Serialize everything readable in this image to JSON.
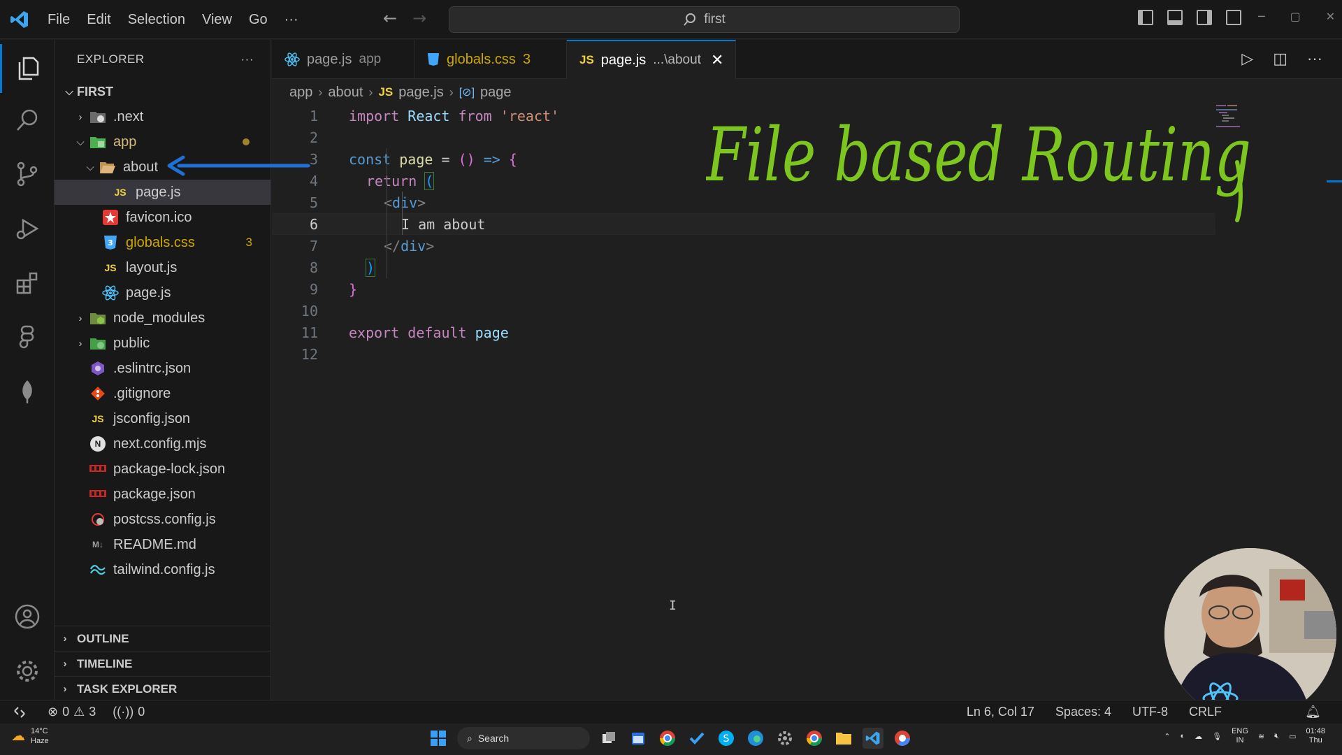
{
  "titlebar": {
    "menu": [
      "File",
      "Edit",
      "Selection",
      "View",
      "Go",
      "···"
    ],
    "search_text": "first"
  },
  "explorer": {
    "header": "EXPLORER",
    "more": "···",
    "root": "FIRST",
    "items": [
      {
        "label": ".next"
      },
      {
        "label": "app"
      },
      {
        "label": "about"
      },
      {
        "label": "page.js",
        "icon_text": "JS"
      },
      {
        "label": "favicon.ico"
      },
      {
        "label": "globals.css",
        "badge": "3"
      },
      {
        "label": "layout.js",
        "icon_text": "JS"
      },
      {
        "label": "page.js"
      },
      {
        "label": "node_modules"
      },
      {
        "label": "public"
      },
      {
        "label": ".eslintrc.json"
      },
      {
        "label": ".gitignore"
      },
      {
        "label": "jsconfig.json",
        "icon_text": "JS"
      },
      {
        "label": "next.config.mjs",
        "icon_text": "N"
      },
      {
        "label": "package-lock.json"
      },
      {
        "label": "package.json"
      },
      {
        "label": "postcss.config.js"
      },
      {
        "label": "README.md",
        "icon_text": "M↓"
      },
      {
        "label": "tailwind.config.js"
      }
    ],
    "sections": [
      "OUTLINE",
      "TIMELINE",
      "TASK EXPLORER"
    ]
  },
  "tabs": [
    {
      "label": "page.js",
      "desc": "app"
    },
    {
      "label": "globals.css",
      "desc": "3"
    },
    {
      "label": "page.js",
      "desc": "...\\about",
      "icon_text": "JS"
    }
  ],
  "breadcrumb": {
    "items": [
      "app",
      "about",
      "page.js",
      "page"
    ],
    "js_text": "JS"
  },
  "code": {
    "line_numbers": [
      "1",
      "2",
      "3",
      "4",
      "5",
      "6",
      "7",
      "8",
      "9",
      "10",
      "11",
      "12"
    ],
    "l1": {
      "import": "import",
      "react": "React",
      "from": "from",
      "mod": "'react'"
    },
    "l3": {
      "const": "const",
      "name": "page",
      "eq": "=",
      "parens": "()",
      "arrow": "=>",
      "brace": "{"
    },
    "l4": {
      "ret": "return",
      "paren": "("
    },
    "l5": {
      "open": "<",
      "tag": "div",
      "close": ">"
    },
    "l6": {
      "text": "I am about"
    },
    "l7": {
      "open": "</",
      "tag": "div",
      "close": ">"
    },
    "l8": {
      "paren": ")"
    },
    "l9": {
      "brace": "}"
    },
    "l11": {
      "export": "export",
      "def": "default",
      "name": "page"
    }
  },
  "annotation": {
    "text": "File based Routing",
    "color": "#7cc61f"
  },
  "statusbar": {
    "errors": "0",
    "warnings": "3",
    "ports": "0",
    "position": "Ln 6, Col 17",
    "spaces": "Spaces: 4",
    "encoding": "UTF-8",
    "eol": "CRLF"
  },
  "taskbar": {
    "temp": "14°C",
    "condition": "Haze",
    "search": "Search",
    "lang1": "ENG",
    "lang2": "IN",
    "time": "01:48",
    "day": "Thu"
  },
  "colors": {
    "accent": "#0078d4",
    "warning": "#cca700",
    "annotation": "#7cc61f",
    "arrow": "#1f6fd6"
  }
}
